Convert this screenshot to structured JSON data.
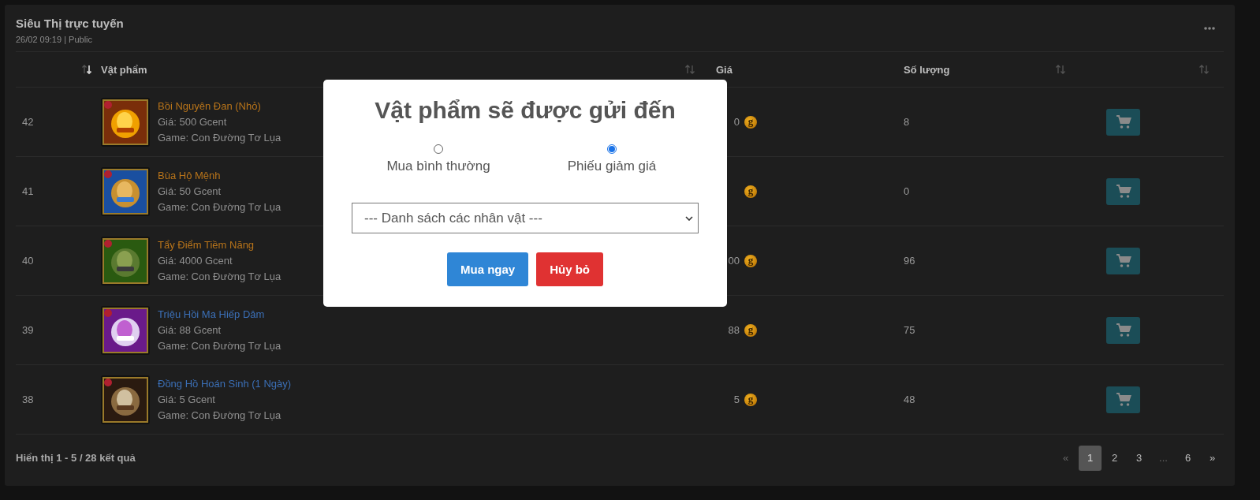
{
  "panel": {
    "title": "Siêu Thị trực tuyến",
    "meta": "26/02 09:19 | Public"
  },
  "table": {
    "columns": [
      {
        "sortable": true,
        "sorted": true
      },
      {
        "label": "Vật phẩm",
        "sortable": true,
        "sorted": false
      },
      {
        "label": "Giá"
      },
      {
        "label": "Số lượng",
        "sortable": true,
        "sorted": false
      },
      {
        "sortable": true,
        "sorted": false
      }
    ],
    "rows": [
      {
        "number": "42",
        "name": "Bồi Nguyên Đan (Nhỏ)",
        "color": "#b8741a",
        "price_line": "Giá: 500 Gcent",
        "game_line": "Game: Con Đường Tơ Lụa",
        "price": "0",
        "currency": "g",
        "quantity": "8"
      },
      {
        "number": "41",
        "name": "Bùa Hộ Mệnh",
        "color": "#b8741a",
        "price_line": "Giá: 50 Gcent",
        "game_line": "Game: Con Đường Tơ Lụa",
        "currency": "g",
        "quantity": "0"
      },
      {
        "number": "40",
        "name": "Tẩy Điểm Tiềm Năng",
        "color": "#b8741a",
        "price_line": "Giá: 4000 Gcent",
        "game_line": "Game: Con Đường Tơ Lụa",
        "price": "00",
        "currency": "g",
        "quantity": "96"
      },
      {
        "number": "39",
        "name": "Triệu Hồi Ma Hiếp Dâm",
        "color": "#3b6fb6",
        "price_line": "Giá: 88 Gcent",
        "game_line": "Game: Con Đường Tơ Lụa",
        "price": "88",
        "currency": "g",
        "quantity": "75"
      },
      {
        "number": "38",
        "name": "Đồng Hồ Hoán Sinh (1 Ngày)",
        "color": "#3b6fb6",
        "price_line": "Giá: 5 Gcent",
        "game_line": "Game: Con Đường Tơ Lụa",
        "price": "5",
        "currency": "g",
        "quantity": "48"
      }
    ]
  },
  "footer": {
    "summary": "Hiển thị 1 - 5 / 28 kết quả",
    "pages": [
      {
        "label": "«",
        "selected": false,
        "disabled": true
      },
      {
        "label": "1",
        "selected": true,
        "disabled": false
      },
      {
        "label": "2",
        "selected": false,
        "disabled": false
      },
      {
        "label": "3",
        "selected": false,
        "disabled": false
      },
      {
        "label": "...",
        "selected": false,
        "disabled": true
      },
      {
        "label": "6",
        "selected": false,
        "disabled": false
      },
      {
        "label": "»",
        "selected": false,
        "disabled": false
      }
    ]
  },
  "dialog": {
    "title": "Vật phẩm sẽ được gửi đến",
    "options": [
      {
        "label": "Mua bình thường",
        "selected": false
      },
      {
        "label": "Phiếu giảm giá",
        "selected": true
      }
    ],
    "select": {
      "value": "--- Danh sách các nhân vật ---"
    },
    "buttons": [
      {
        "label": "Mua ngay",
        "kind": "primary"
      },
      {
        "label": "Hủy bỏ",
        "kind": "danger"
      }
    ]
  }
}
